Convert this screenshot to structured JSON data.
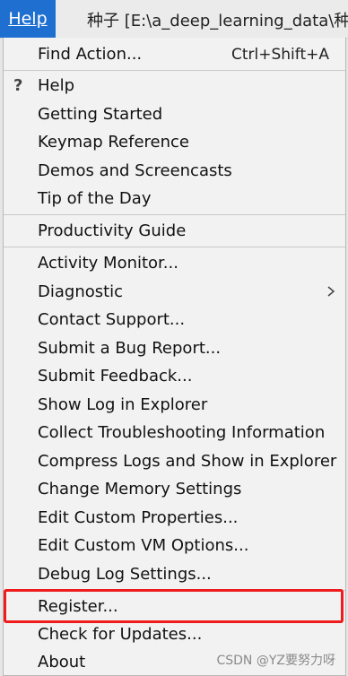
{
  "menubar": {
    "help_label": "Help",
    "window_title": "种子 [E:\\a_deep_learning_data\\种子"
  },
  "menu": {
    "items": [
      {
        "label": "Find Action...",
        "shortcut": "Ctrl+Shift+A"
      },
      {
        "label": "Help",
        "icon": "question-icon"
      },
      {
        "label": "Getting Started"
      },
      {
        "label": "Keymap Reference"
      },
      {
        "label": "Demos and Screencasts"
      },
      {
        "label": "Tip of the Day"
      },
      {
        "label": "Productivity Guide"
      },
      {
        "label": "Activity Monitor..."
      },
      {
        "label": "Diagnostic",
        "icon": "chevron-right-icon"
      },
      {
        "label": "Contact Support..."
      },
      {
        "label": "Submit a Bug Report..."
      },
      {
        "label": "Submit Feedback..."
      },
      {
        "label": "Show Log in Explorer"
      },
      {
        "label": "Collect Troubleshooting Information"
      },
      {
        "label": "Compress Logs and Show in Explorer"
      },
      {
        "label": "Change Memory Settings"
      },
      {
        "label": "Edit Custom Properties..."
      },
      {
        "label": "Edit Custom VM Options..."
      },
      {
        "label": "Debug Log Settings..."
      },
      {
        "label": "Register..."
      },
      {
        "label": "Check for Updates..."
      },
      {
        "label": "About"
      }
    ],
    "question_glyph": "?"
  },
  "watermark": "CSDN @YZ要努力呀",
  "colors": {
    "menubar_active": "#1f6fd1",
    "highlight_border": "#ee1c1c"
  }
}
